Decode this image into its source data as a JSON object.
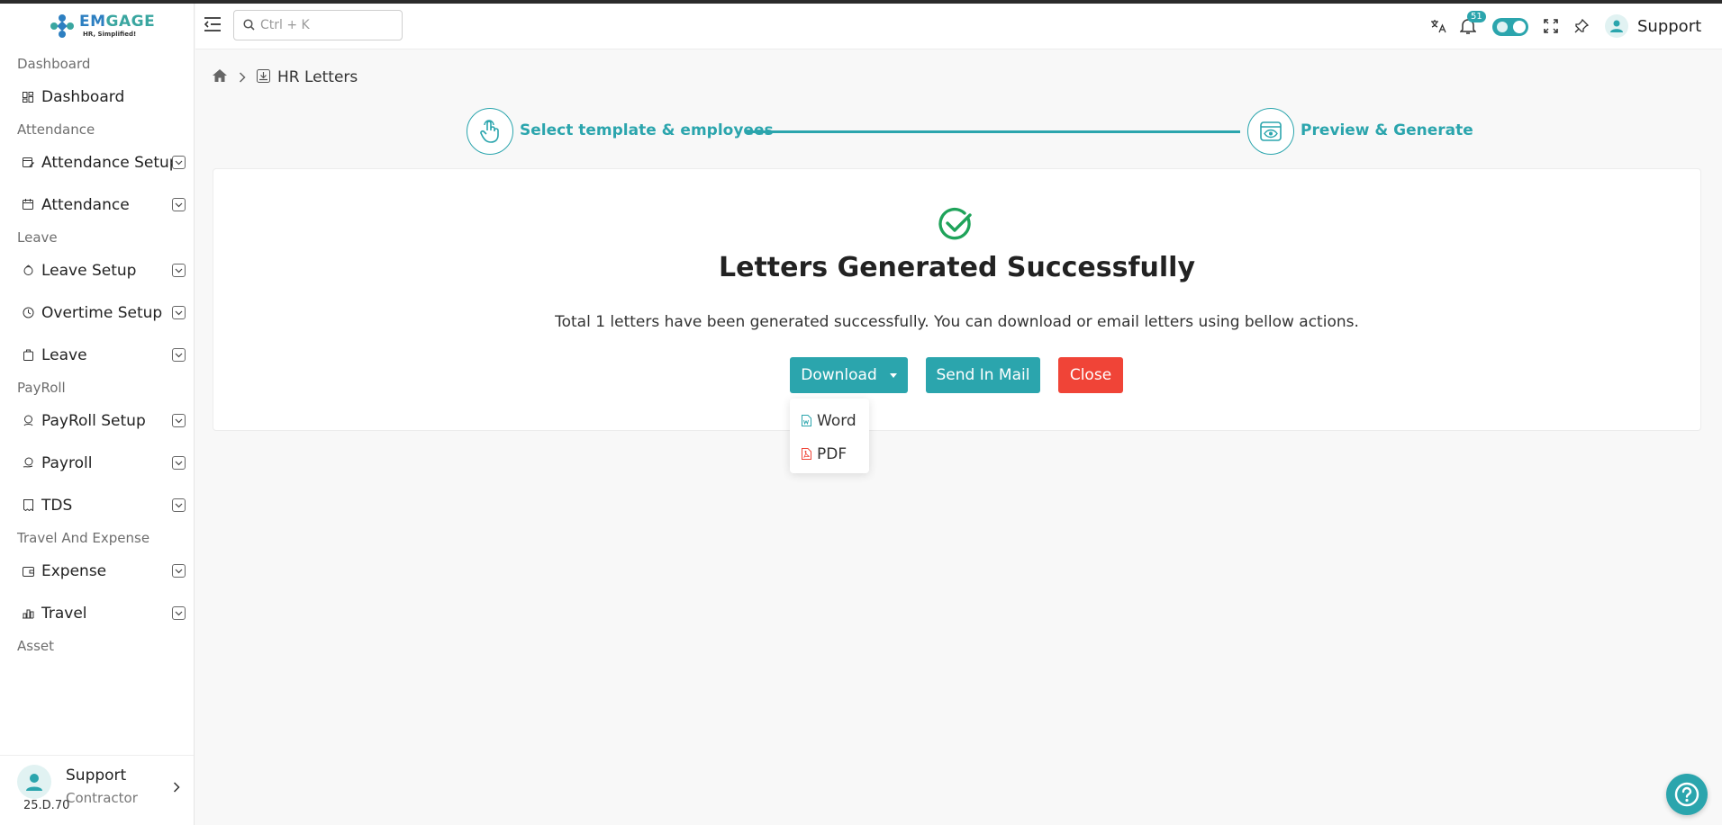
{
  "brand": {
    "name_part1": "EM",
    "name_part2": "GAGE",
    "tagline": "HR, Simplified!"
  },
  "search": {
    "placeholder": "Ctrl + K"
  },
  "header": {
    "notification_count": "51",
    "user_name": "Support"
  },
  "sidebar": {
    "sections": {
      "dashboard": "Dashboard",
      "attendance": "Attendance",
      "leave": "Leave",
      "payroll": "PayRoll",
      "travel_expense": "Travel And Expense",
      "asset": "Asset"
    },
    "items": {
      "dashboard": "Dashboard",
      "attendance_setup": "Attendance Setup",
      "attendance": "Attendance",
      "leave_setup": "Leave Setup",
      "overtime_setup": "Overtime Setup",
      "leave": "Leave",
      "payroll_setup": "PayRoll Setup",
      "payroll": "Payroll",
      "tds": "TDS",
      "expense": "Expense",
      "travel": "Travel"
    },
    "footer": {
      "name": "Support",
      "role": "Contractor",
      "version": "25.D.70"
    }
  },
  "breadcrumb": {
    "current": "HR Letters"
  },
  "stepper": {
    "step1": "Select template & employees",
    "step2": "Preview & Generate"
  },
  "result": {
    "title": "Letters Generated Successfully",
    "message": "Total 1 letters have been generated successfully. You can download or email letters using bellow actions."
  },
  "actions": {
    "download": "Download",
    "send_mail": "Send In Mail",
    "close": "Close",
    "download_options": {
      "word": "Word",
      "pdf": "PDF"
    }
  },
  "colors": {
    "accent": "#2ba5ad",
    "danger": "#f04437",
    "success": "#1fa35a"
  }
}
